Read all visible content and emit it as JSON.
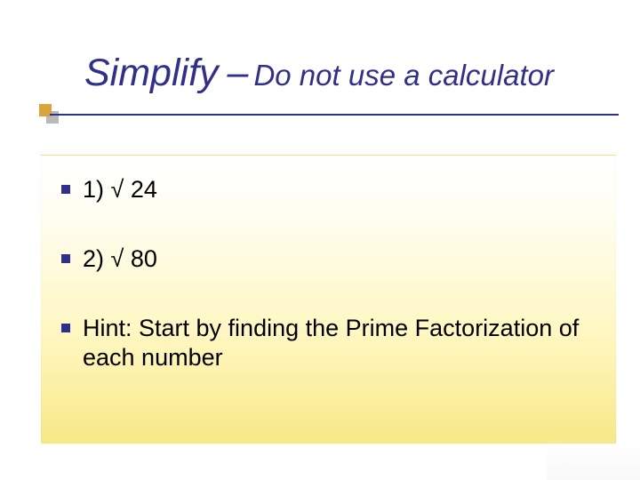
{
  "title": {
    "main": "Simplify",
    "dash": "–",
    "sub": "Do not use a calculator"
  },
  "bullets": [
    {
      "text": "1) √ 24"
    },
    {
      "text": "2) √ 80"
    },
    {
      "text": "Hint: Start by finding the Prime Factorization of each number"
    }
  ],
  "colors": {
    "accent": "#2f2f8f",
    "gold": "#d9a43b"
  }
}
